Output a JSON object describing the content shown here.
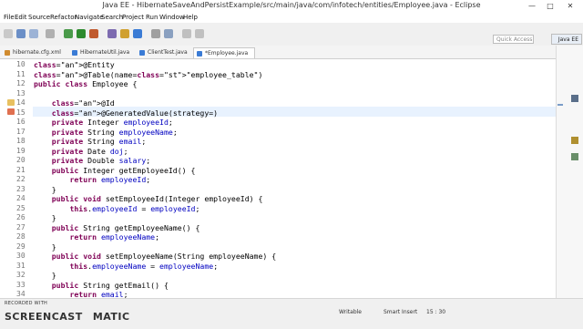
{
  "window": {
    "title": "Java EE - HibernateSaveAndPersistExample/src/main/java/com/infotech/entities/Employee.java - Eclipse",
    "minimize": "—",
    "maximize": "□",
    "close": "✕"
  },
  "menu": [
    "File",
    "Edit",
    "Source",
    "Refactor",
    "Navigate",
    "Search",
    "Project",
    "Run",
    "Window",
    "Help"
  ],
  "toolbar": {
    "quick_access_placeholder": "Quick Access",
    "perspective_label": "Java EE"
  },
  "tabs": [
    {
      "label": "hibernate.cfg.xml",
      "active": false,
      "icon_color": "#d08b2f"
    },
    {
      "label": "HibernateUtil.java",
      "active": false,
      "icon_color": "#3a7bd5"
    },
    {
      "label": "ClientTest.java",
      "active": false,
      "icon_color": "#3a7bd5"
    },
    {
      "label": "*Employee.java",
      "active": true,
      "icon_color": "#3a7bd5"
    }
  ],
  "editor": {
    "lines": [
      {
        "n": "10",
        "text": "@Entity"
      },
      {
        "n": "11",
        "text": "@Table(name=\"employee_table\")"
      },
      {
        "n": "12",
        "text": "public class Employee {"
      },
      {
        "n": "13",
        "text": ""
      },
      {
        "n": "14",
        "text": "    @Id"
      },
      {
        "n": "15",
        "text": "    @GeneratedValue(strategy=)"
      },
      {
        "n": "16",
        "text": "    private Integer employeeId;"
      },
      {
        "n": "17",
        "text": "    private String employeeName;"
      },
      {
        "n": "18",
        "text": "    private String email;"
      },
      {
        "n": "19",
        "text": "    private Date doj;"
      },
      {
        "n": "20",
        "text": "    private Double salary;"
      },
      {
        "n": "21",
        "text": "    public Integer getEmployeeId() {"
      },
      {
        "n": "22",
        "text": "        return employeeId;"
      },
      {
        "n": "23",
        "text": "    }"
      },
      {
        "n": "24",
        "text": "    public void setEmployeeId(Integer employeeId) {"
      },
      {
        "n": "25",
        "text": "        this.employeeId = employeeId;"
      },
      {
        "n": "26",
        "text": "    }"
      },
      {
        "n": "27",
        "text": "    public String getEmployeeName() {"
      },
      {
        "n": "28",
        "text": "        return employeeName;"
      },
      {
        "n": "29",
        "text": "    }"
      },
      {
        "n": "30",
        "text": "    public void setEmployeeName(String employeeName) {"
      },
      {
        "n": "31",
        "text": "        this.employeeName = employeeName;"
      },
      {
        "n": "32",
        "text": "    }"
      },
      {
        "n": "33",
        "text": "    public String getEmail() {"
      },
      {
        "n": "34",
        "text": "        return email;"
      }
    ]
  },
  "status": {
    "writable": "Writable",
    "insert_mode": "Smart Insert",
    "position": "15 : 30"
  },
  "watermark": {
    "line1": "RECORDED WITH",
    "line2": "SCREENCAST",
    "line3": "MATIC"
  }
}
